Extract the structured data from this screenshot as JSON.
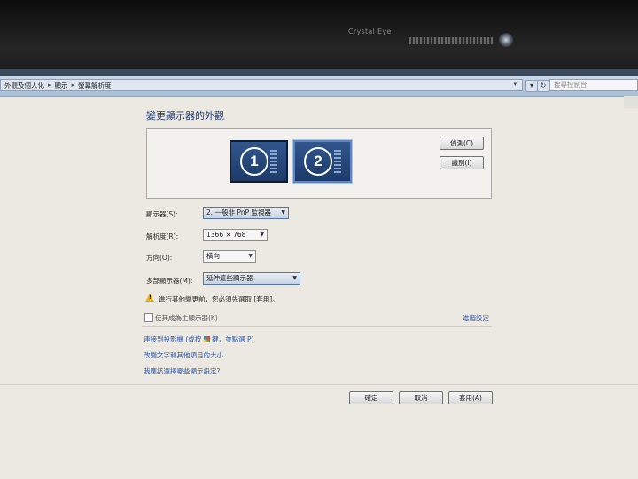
{
  "bezel": {
    "brand": "Crystal Eye"
  },
  "address_bar": {
    "crumbs": [
      "外觀及個人化",
      "顯示",
      "螢幕解析度"
    ],
    "search_placeholder": "搜尋控制台"
  },
  "page": {
    "title": "變更顯示器的外觀"
  },
  "monitors": [
    {
      "number": "1",
      "selected": false
    },
    {
      "number": "2",
      "selected": true
    }
  ],
  "buttons": {
    "detect": "偵測(C)",
    "identify": "識別(I)",
    "ok": "確定",
    "cancel": "取消",
    "apply": "套用(A)"
  },
  "fields": {
    "display_label": "顯示器(S):",
    "display_value": "2. 一般非 PnP 監視器",
    "resolution_label": "解析度(R):",
    "resolution_value": "1366 × 768",
    "orientation_label": "方向(O):",
    "orientation_value": "橫向",
    "multi_label": "多部顯示器(M):",
    "multi_value": "延伸這些顯示器"
  },
  "warning": "進行其他變更前，您必須先選取 [套用]。",
  "main_display_checkbox": {
    "label": "使其成為主顯示器(K)",
    "checked": false
  },
  "advanced_link": "進階設定",
  "links": {
    "projector_pre": "連接到投影機 (或按",
    "projector_post": "鍵，並點選 P)",
    "text_size": "改變文字和其他項目的大小",
    "which_settings": "我應該選擇哪些顯示設定?"
  }
}
